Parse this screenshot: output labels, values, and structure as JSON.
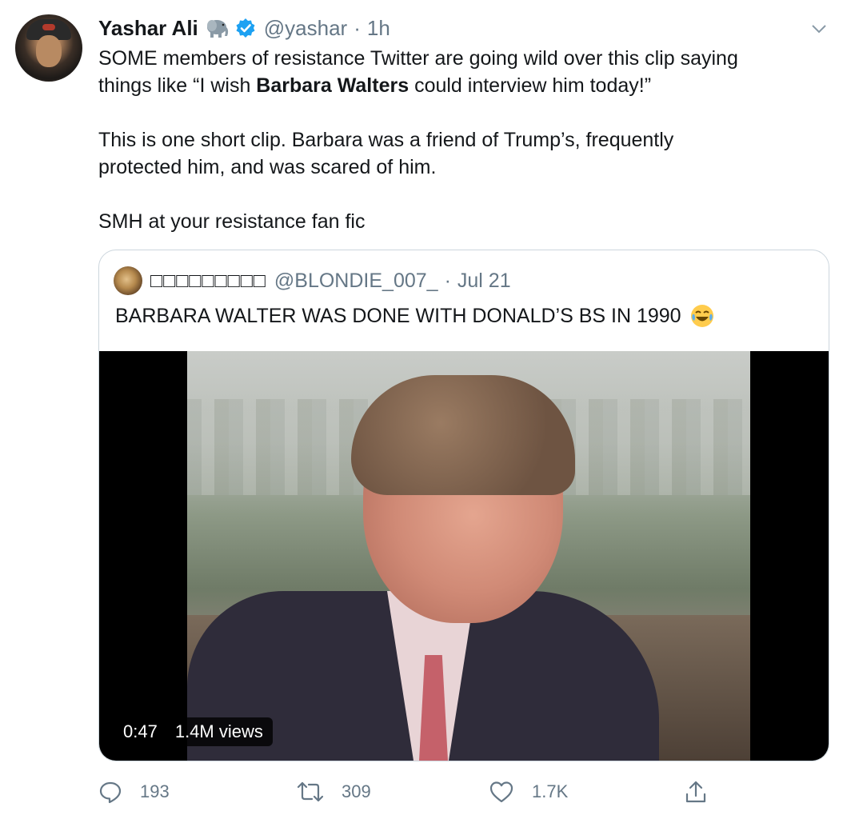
{
  "tweet": {
    "author_name": "Yashar Ali",
    "handle": "@yashar",
    "time": "1h",
    "separator": "·",
    "lines": [
      {
        "pre": "SOME members of resistance Twitter are going wild over this clip saying",
        "bold": "",
        "post": ""
      },
      {
        "pre": "things like “I wish ",
        "bold": "Barbara Walters",
        "post": " could interview him today!”"
      },
      {
        "pre": "This is one short clip. Barbara was a friend of Trump’s, frequently",
        "bold": "",
        "post": ""
      },
      {
        "pre": "protected him, and was scared of him.",
        "bold": "",
        "post": ""
      },
      {
        "pre": "SMH at your resistance fan fic",
        "bold": "",
        "post": ""
      }
    ]
  },
  "quoted": {
    "author_name": "□□□□□□□□□",
    "handle": "@BLONDIE_007_",
    "date": "Jul 21",
    "separator": "·",
    "text": "BARBARA WALTER WAS DONE WITH DONALD’S BS IN 1990",
    "video": {
      "duration": "0:47",
      "views": "1.4M views"
    }
  },
  "actions": {
    "replies": "193",
    "retweets": "309",
    "likes": "1.7K"
  },
  "colors": {
    "verified": "#1da1f2",
    "secondary_text": "#657786",
    "border": "#ccd6dd"
  },
  "icons": [
    "elephant-emoji-icon",
    "verified-badge-icon",
    "chevron-down-icon",
    "laughing-emoji-icon",
    "reply-icon",
    "retweet-icon",
    "like-icon",
    "share-icon"
  ]
}
